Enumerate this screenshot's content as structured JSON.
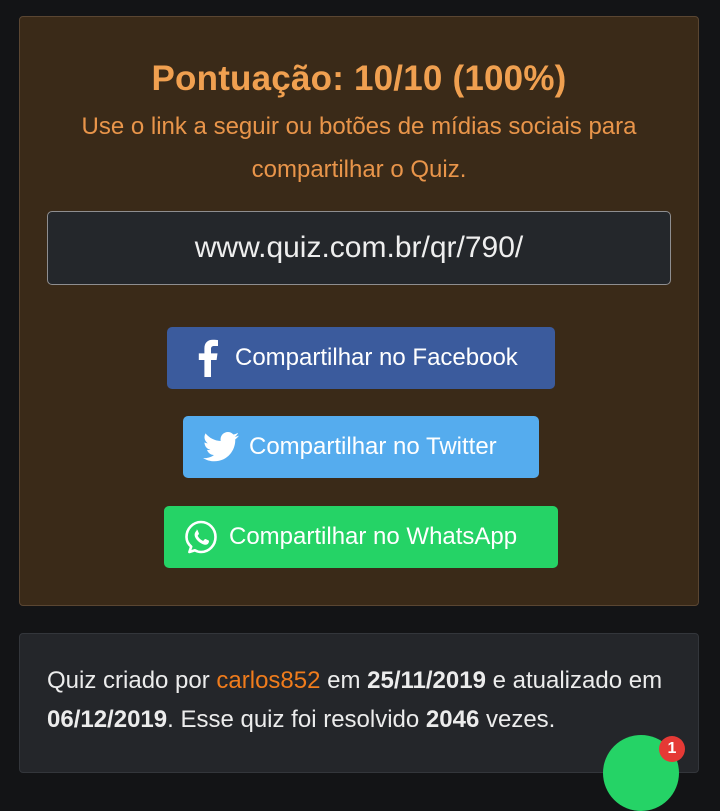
{
  "result": {
    "score_text": "Pontuação: 10/10 (100%)",
    "share_message": "Use o link a seguir ou botões de mídias sociais para compartilhar o Quiz.",
    "share_link": "www.quiz.com.br/qr/790/"
  },
  "share_buttons": {
    "facebook": {
      "label": "Compartilhar no Facebook",
      "icon": "facebook-icon",
      "color": "#3b5b9d"
    },
    "twitter": {
      "label": "Compartilhar no Twitter",
      "icon": "twitter-icon",
      "color": "#55acee"
    },
    "whatsapp": {
      "label": "Compartilhar no WhatsApp",
      "icon": "whatsapp-icon",
      "color": "#25d366"
    }
  },
  "quiz_info": {
    "prefix": "Quiz criado por ",
    "author": "carlos852",
    "created_prefix": " em ",
    "created_date": "25/11/2019",
    "updated_prefix": " e atualizado em ",
    "updated_date": "06/12/2019",
    "solved_prefix": ". Esse quiz foi resolvido ",
    "solved_count": "2046",
    "solved_suffix": " vezes."
  },
  "floating_button": {
    "icon": "whatsapp-icon",
    "badge": "1"
  },
  "colors": {
    "accent": "#f0a050",
    "author_link": "#f07c1c",
    "page_background": "#131416"
  }
}
